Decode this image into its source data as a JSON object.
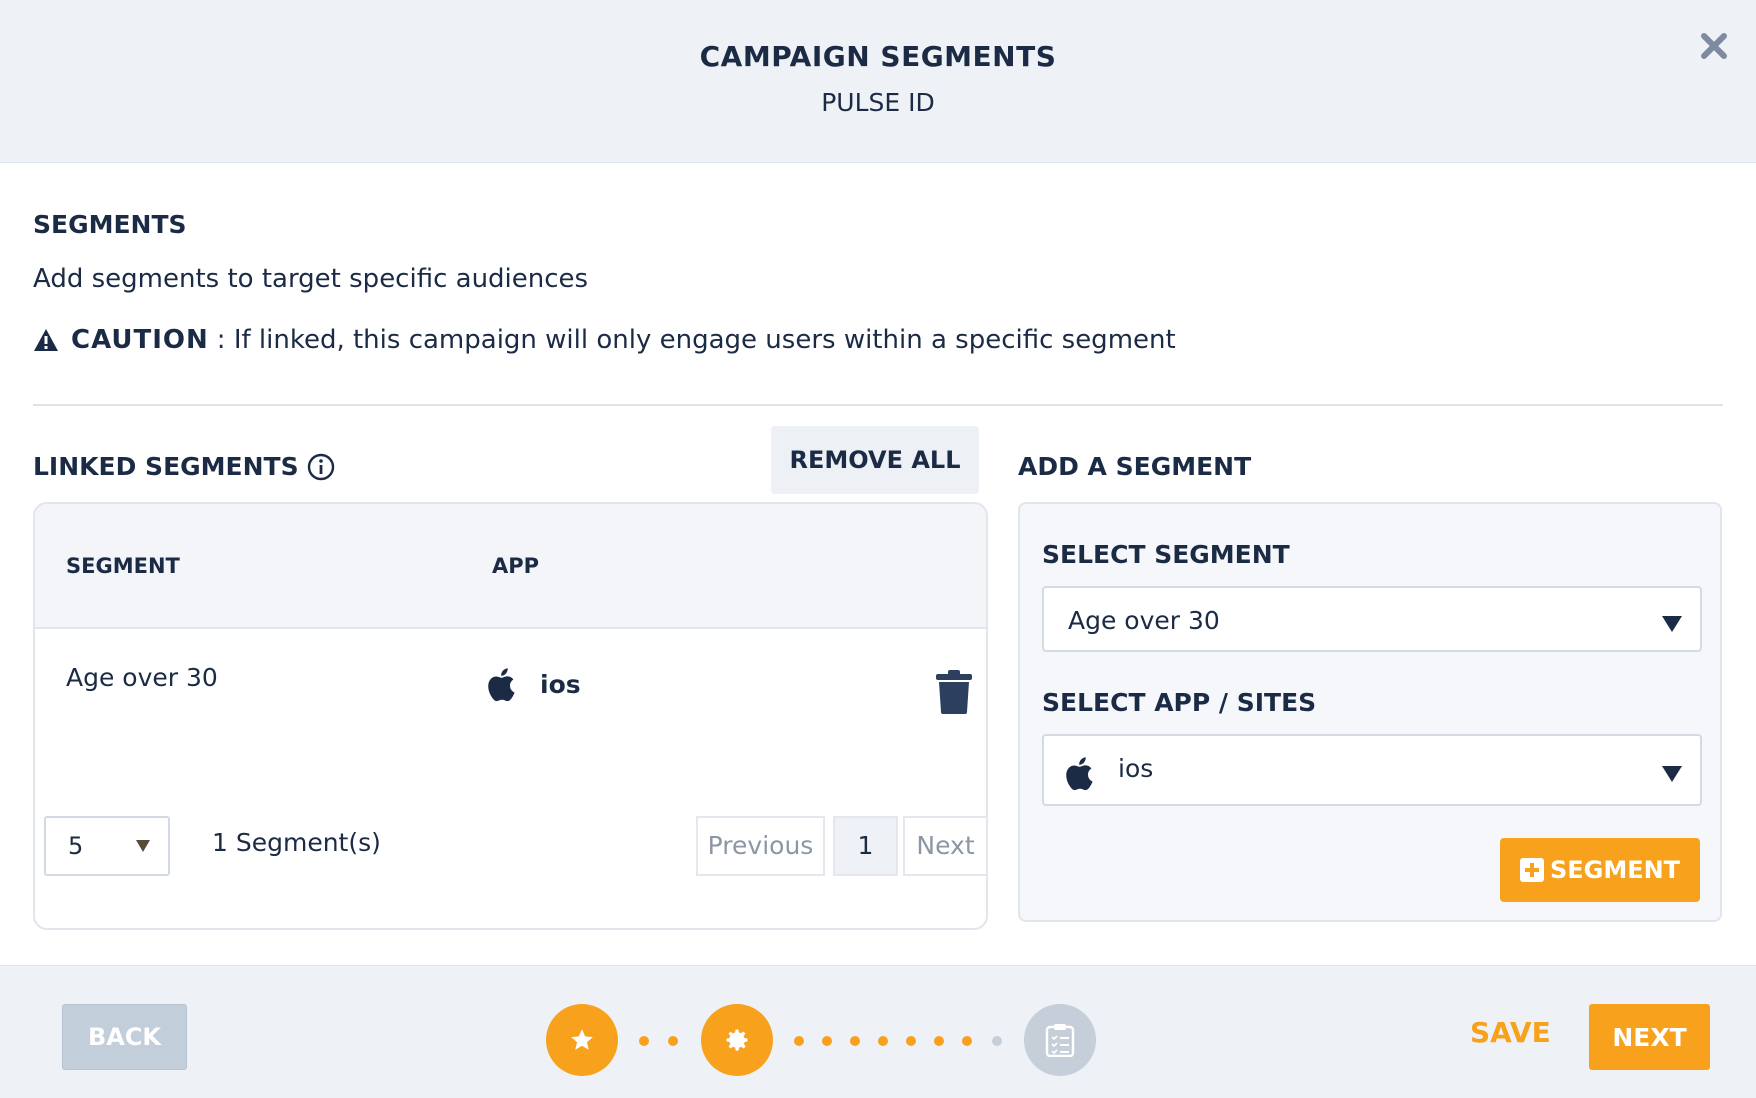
{
  "header": {
    "title": "CAMPAIGN SEGMENTS",
    "subtitle": "PULSE ID",
    "close_icon": "close-icon"
  },
  "segments_section": {
    "heading": "SEGMENTS",
    "description": "Add segments to target specific audiences",
    "caution_label": "CAUTION",
    "caution_text": ": If linked, this campaign will only engage users within a specific segment"
  },
  "linked": {
    "title": "LINKED SEGMENTS",
    "remove_all_label": "REMOVE ALL",
    "columns": [
      "SEGMENT",
      "APP"
    ],
    "rows": [
      {
        "segment": "Age over 30",
        "app": "ios",
        "app_icon": "apple-icon"
      }
    ],
    "per_page": "5",
    "count_text": "1 Segment(s)",
    "pagination": {
      "previous": "Previous",
      "current": "1",
      "next": "Next"
    }
  },
  "add_segment": {
    "title": "ADD A SEGMENT",
    "select_segment_label": "SELECT SEGMENT",
    "select_segment_value": "Age over 30",
    "select_app_label": "SELECT APP / SITES",
    "select_app_value": "ios",
    "add_button_label": "SEGMENT"
  },
  "footer": {
    "back_label": "BACK",
    "save_label": "SAVE",
    "next_label": "NEXT",
    "steps": [
      "star-icon",
      "gear-icon",
      "clipboard-icon"
    ]
  },
  "colors": {
    "accent": "#f7a11d",
    "text": "#1c2b45",
    "panel": "#eef1f6",
    "inactive": "#c5ced9"
  }
}
